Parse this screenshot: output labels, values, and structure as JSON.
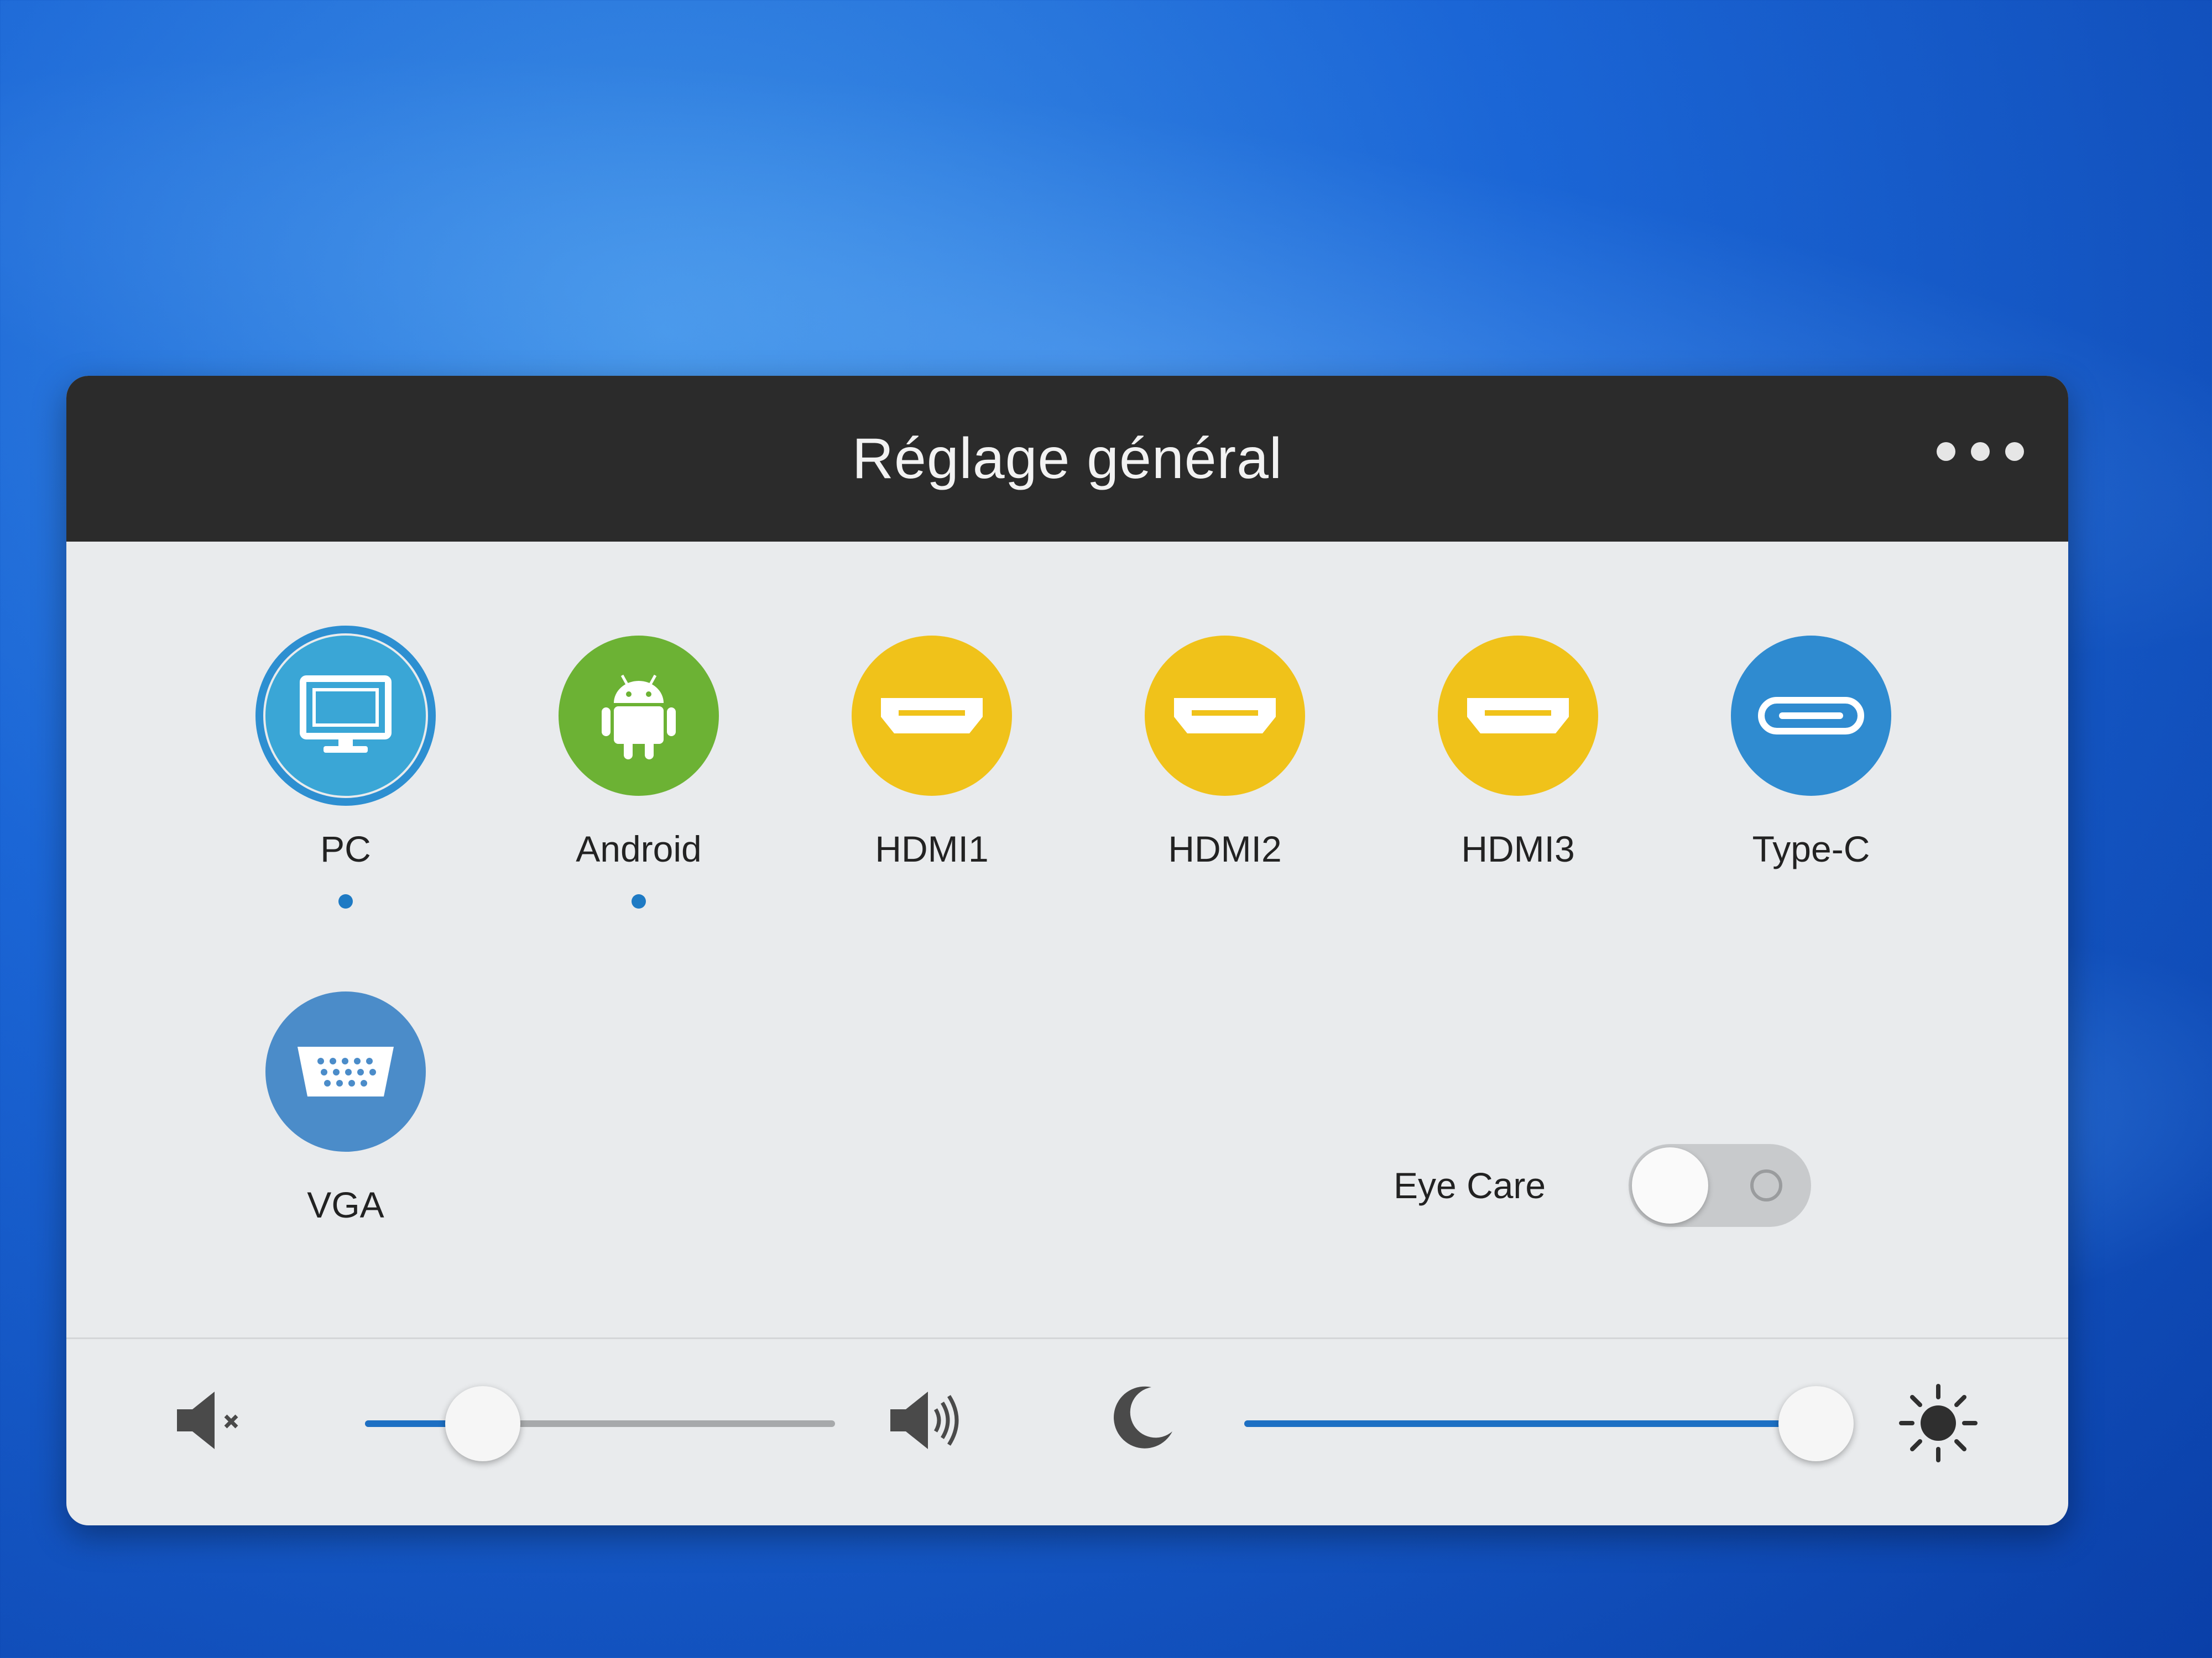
{
  "window": {
    "title": "Réglage général"
  },
  "sources": [
    {
      "label": "PC",
      "icon": "monitor-icon",
      "color": "#3aa6d6",
      "active": true,
      "indicator": true
    },
    {
      "label": "Android",
      "icon": "android-icon",
      "color": "#6cb234",
      "active": false,
      "indicator": true
    },
    {
      "label": "HDMI1",
      "icon": "hdmi-icon",
      "color": "#f0c21a",
      "active": false,
      "indicator": false
    },
    {
      "label": "HDMI2",
      "icon": "hdmi-icon",
      "color": "#f0c21a",
      "active": false,
      "indicator": false
    },
    {
      "label": "HDMI3",
      "icon": "hdmi-icon",
      "color": "#f0c21a",
      "active": false,
      "indicator": false
    },
    {
      "label": "Type-C",
      "icon": "usb-c-icon",
      "color": "#2f8bd0",
      "active": false,
      "indicator": false
    },
    {
      "label": "VGA",
      "icon": "vga-icon",
      "color": "#4b8cc9",
      "active": false,
      "indicator": false
    }
  ],
  "eye_care": {
    "label": "Eye Care",
    "enabled": false
  },
  "volume": {
    "level": 0.25,
    "min_icon": "speaker-mute-icon",
    "max_icon": "speaker-loud-icon"
  },
  "brightness": {
    "level": 0.94,
    "min_icon": "moon-icon",
    "max_icon": "sun-icon"
  },
  "colors": {
    "accent": "#1d6fc3",
    "titlebar": "#2b2b2b",
    "panel": "#e9ebed"
  }
}
